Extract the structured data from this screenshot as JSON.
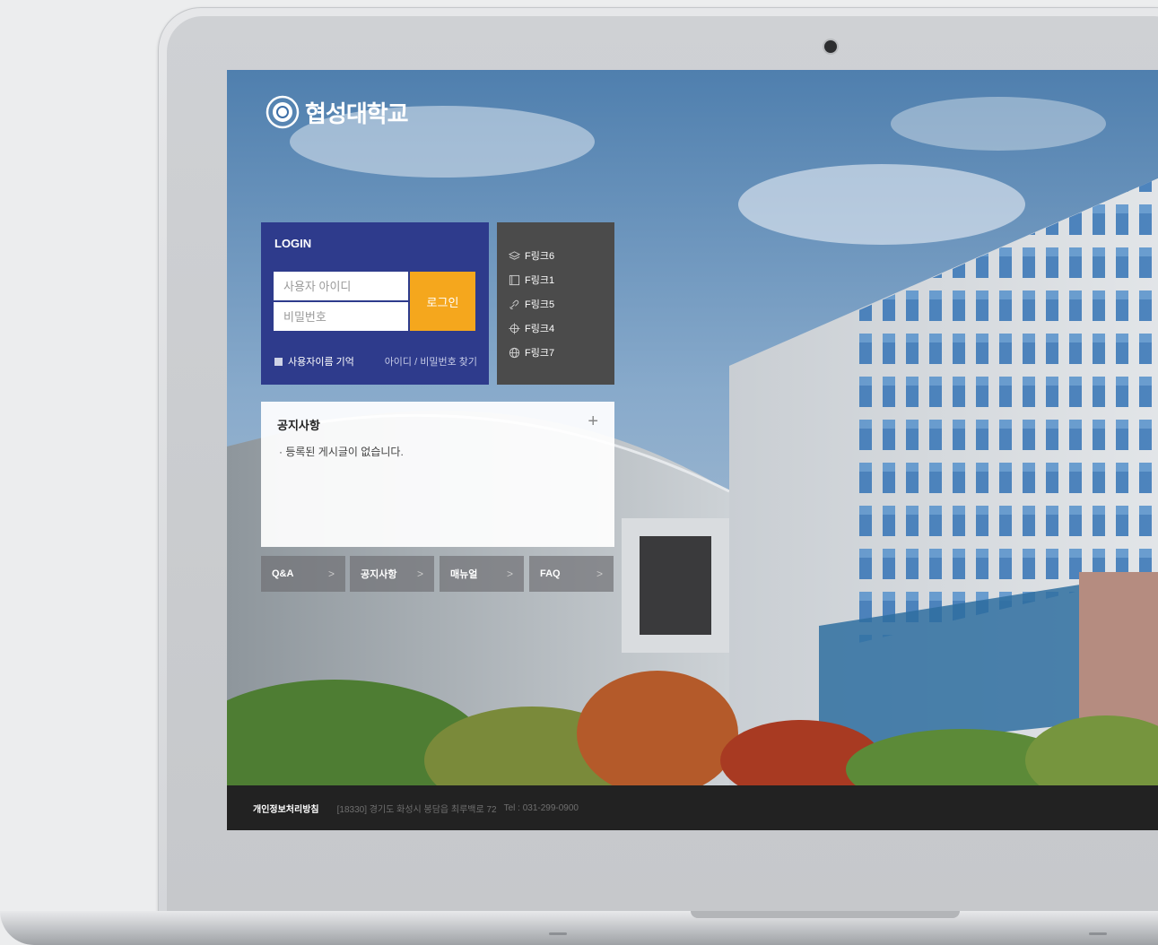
{
  "brand": {
    "name": "협성대학교"
  },
  "login": {
    "title": "LOGIN",
    "id_placeholder": "사용자 아이디",
    "pw_placeholder": "비밀번호",
    "submit_label": "로그인",
    "remember_label": "사용자이름 기억",
    "find_label": "아이디 / 비밀번호 찾기"
  },
  "quick_links": [
    {
      "label": "F링크6",
      "icon": "layers-icon"
    },
    {
      "label": "F링크1",
      "icon": "book-icon"
    },
    {
      "label": "F링크5",
      "icon": "link-icon"
    },
    {
      "label": "F링크4",
      "icon": "crosshair-icon"
    },
    {
      "label": "F링크7",
      "icon": "globe-icon"
    }
  ],
  "notice": {
    "title": "공지사항",
    "plus": "+",
    "empty_message": "· 등록된 게시글이 없습니다."
  },
  "nav_buttons": [
    {
      "label": "Q&A",
      "arrow": ">"
    },
    {
      "label": "공지사항",
      "arrow": ">"
    },
    {
      "label": "매뉴얼",
      "arrow": ">"
    },
    {
      "label": "FAQ",
      "arrow": ">"
    }
  ],
  "footer": {
    "privacy": "개인정보처리방침",
    "address": "[18330] 경기도 화성시 봉담읍 최루백로 72",
    "tel": "Tel : 031-299-0900"
  },
  "colors": {
    "login_bg": "#2e3b8c",
    "login_button": "#f5a71d",
    "quick_links_bg": "#4b4b4b",
    "footer_bg": "#222222"
  }
}
